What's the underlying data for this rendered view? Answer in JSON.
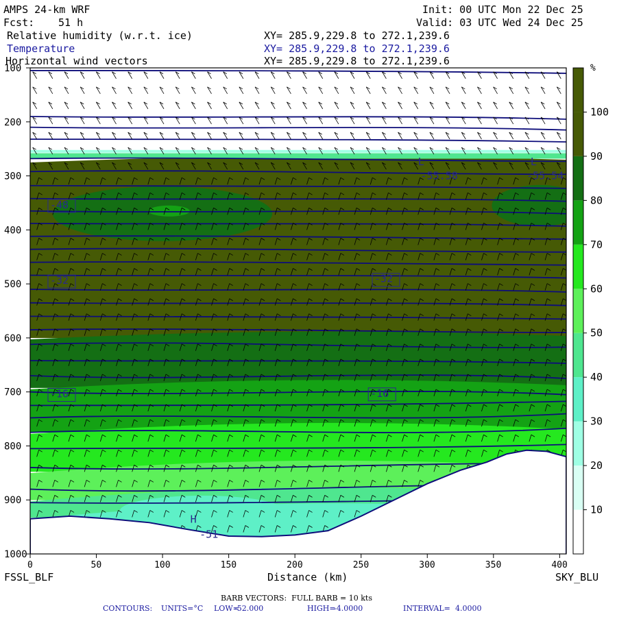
{
  "header": {
    "model": "AMPS 24-km WRF",
    "init": "Init: 00 UTC Mon 22 Dec 25",
    "fcst_label": "Fcst:",
    "fcst_value": "51 h",
    "valid": "Valid: 03 UTC Wed 24 Dec 25",
    "fields": [
      {
        "name": "Relative humidity (w.r.t. ice)",
        "xy": "XY= 285.9,229.8 to 272.1,239.6"
      },
      {
        "name": "Temperature",
        "xy": "XY= 285.9,229.8 to 272.1,239.6"
      },
      {
        "name": "Horizontal wind vectors",
        "xy": "XY= 285.9,229.8 to 272.1,239.6"
      }
    ]
  },
  "colors": {
    "rh": [
      "#ffffff",
      "#d9fff4",
      "#9fffe4",
      "#5ef0c7",
      "#4fe68f",
      "#5df05a",
      "#25e81f",
      "#14a214",
      "#146f14",
      "#465a05"
    ],
    "contour": "#0d0d7a",
    "label": "#2a2a8a"
  },
  "chart_data": {
    "type": "heatmap",
    "title": "Relative humidity (w.r.t. ice)",
    "xlabel": "Distance (km)",
    "ylabel": "",
    "xlim": [
      0,
      405
    ],
    "ylim": [
      1000,
      100
    ],
    "x_ticks": [
      0,
      50,
      100,
      150,
      200,
      250,
      300,
      350,
      400
    ],
    "y_ticks": [
      100,
      200,
      300,
      400,
      500,
      600,
      700,
      800,
      900,
      1000
    ],
    "endpoints": {
      "left": "FSSL_BLF",
      "right": "SKY_BLU"
    },
    "colorbar": {
      "unit": "%",
      "levels": [
        10,
        20,
        30,
        40,
        50,
        60,
        70,
        80,
        90,
        100
      ]
    },
    "terrain_pressure": [
      [
        0,
        935
      ],
      [
        30,
        930
      ],
      [
        60,
        935
      ],
      [
        90,
        942
      ],
      [
        120,
        955
      ],
      [
        150,
        967
      ],
      [
        175,
        968
      ],
      [
        200,
        965
      ],
      [
        225,
        957
      ],
      [
        250,
        930
      ],
      [
        275,
        900
      ],
      [
        300,
        870
      ],
      [
        325,
        845
      ],
      [
        345,
        830
      ],
      [
        360,
        815
      ],
      [
        375,
        808
      ],
      [
        390,
        810
      ],
      [
        405,
        820
      ]
    ],
    "rh_regions": [
      {
        "rh": 100,
        "pressure_top": 265,
        "pressure_bottom": 590,
        "desc": "upper saturated layer"
      },
      {
        "rh": 90,
        "pressure_top": 590,
        "pressure_bottom": 680
      },
      {
        "rh": 80,
        "pressure_top": 680,
        "pressure_bottom": 760
      },
      {
        "rh": 70,
        "pressure_top": 760,
        "pressure_bottom": 830
      },
      {
        "rh": 60,
        "pressure_top": 830,
        "pressure_bottom": 880
      },
      {
        "rh": 50,
        "pressure_top": 880,
        "pressure_bottom": 910
      },
      {
        "rh": 40,
        "pressure_top": 910,
        "pressure_bottom": 945
      }
    ],
    "temperature_labels": [
      {
        "text": "-48",
        "x": 15,
        "p": 360
      },
      {
        "text": "-32",
        "x": 15,
        "p": 500
      },
      {
        "text": "-32",
        "x": 260,
        "p": 497
      },
      {
        "text": "-16",
        "x": 15,
        "p": 710
      },
      {
        "text": "-16",
        "x": 257,
        "p": 709
      },
      {
        "text": "-55.58",
        "x": 295,
        "p": 306
      },
      {
        "text": "-55.54",
        "x": 375,
        "p": 306
      },
      {
        "text": "-51",
        "x": 128,
        "p": 970
      }
    ],
    "extrema": [
      {
        "text": "L",
        "x": 293,
        "p": 280
      },
      {
        "text": "L",
        "x": 378,
        "p": 280
      },
      {
        "text": "H",
        "x": 121,
        "p": 942
      }
    ],
    "temperature_levels_p": [
      105,
      190,
      210,
      232,
      268,
      292,
      318,
      342,
      365,
      388,
      412,
      436,
      460,
      484,
      510,
      535,
      560,
      585,
      612,
      642,
      670,
      700,
      725,
      748,
      775,
      805,
      840,
      880,
      905
    ]
  },
  "footer": {
    "barb": "BARB VECTORS:  FULL BARB = 10 kts",
    "contours_label": "CONTOURS:",
    "contours_units": "UNITS=°C",
    "low_label": "LOW=",
    "low": "-52.000",
    "high_label": "HIGH=",
    "high": "-4.0000",
    "interval_label": "INTERVAL=",
    "interval": "4.0000"
  }
}
